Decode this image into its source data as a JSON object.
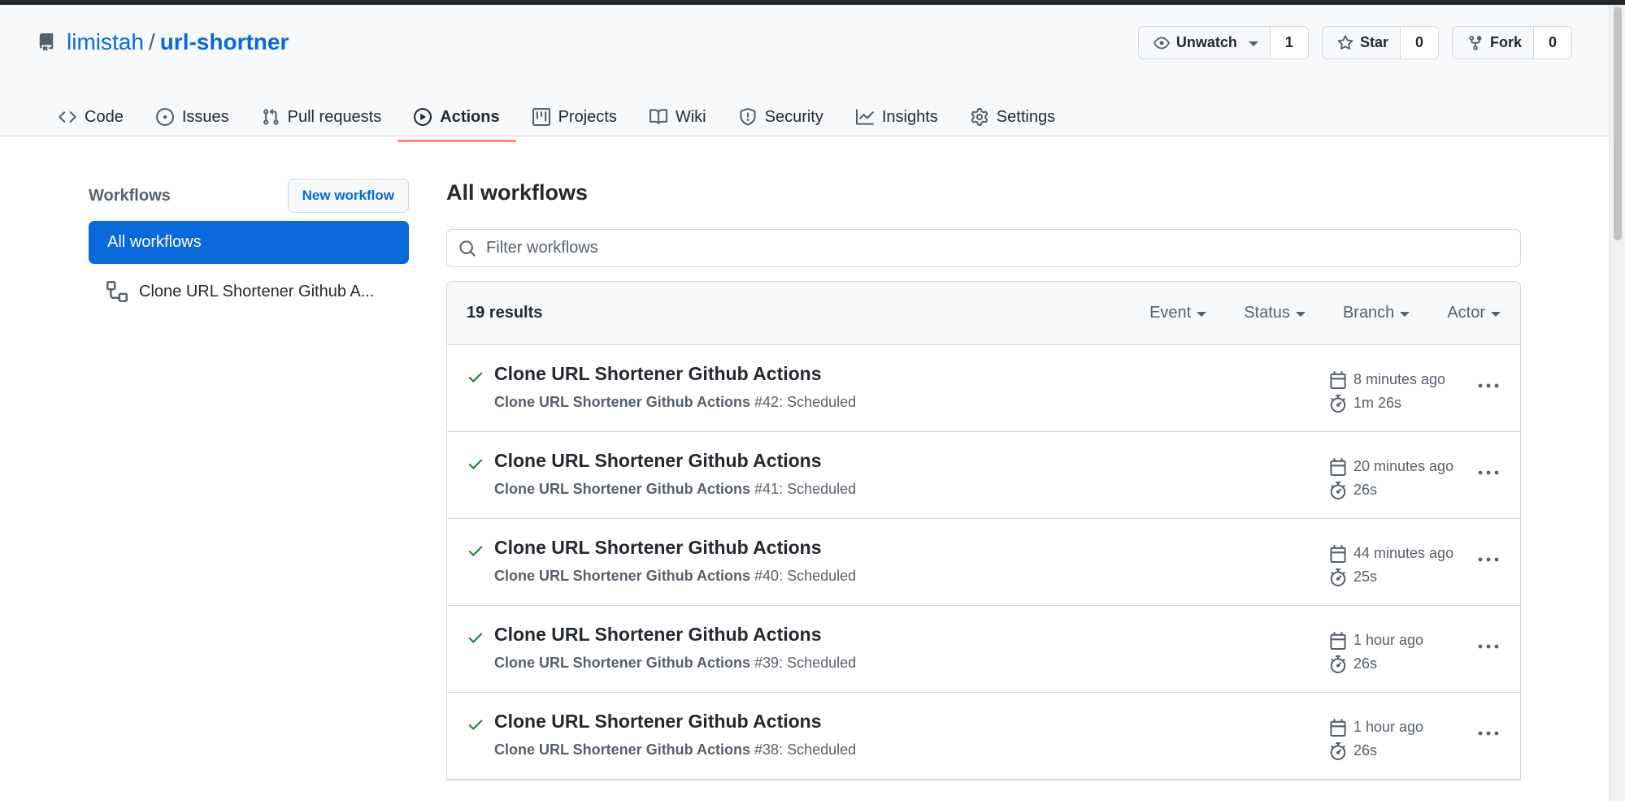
{
  "repo": {
    "owner": "limistah",
    "separator": "/",
    "name": "url-shortner",
    "icon": "repo-icon"
  },
  "actions": {
    "watch": {
      "label": "Unwatch",
      "count": "1",
      "icon": "eye-icon"
    },
    "star": {
      "label": "Star",
      "count": "0",
      "icon": "star-icon"
    },
    "fork": {
      "label": "Fork",
      "count": "0",
      "icon": "fork-icon"
    }
  },
  "tabs": [
    {
      "label": "Code",
      "icon": "code-icon"
    },
    {
      "label": "Issues",
      "icon": "issue-icon"
    },
    {
      "label": "Pull requests",
      "icon": "pull-request-icon"
    },
    {
      "label": "Actions",
      "icon": "play-icon",
      "active": true
    },
    {
      "label": "Projects",
      "icon": "project-icon"
    },
    {
      "label": "Wiki",
      "icon": "book-icon"
    },
    {
      "label": "Security",
      "icon": "shield-icon"
    },
    {
      "label": "Insights",
      "icon": "graph-icon"
    },
    {
      "label": "Settings",
      "icon": "gear-icon"
    }
  ],
  "sidebar": {
    "title": "Workflows",
    "new_workflow": "New workflow",
    "active_item": "All workflows",
    "items": [
      {
        "label": "Clone URL Shortener Github A...",
        "icon": "workflow-icon"
      }
    ]
  },
  "main": {
    "title": "All workflows",
    "filter_placeholder": "Filter workflows",
    "results_count": "19 results",
    "filters": [
      "Event",
      "Status",
      "Branch",
      "Actor"
    ],
    "runs": [
      {
        "title": "Clone URL Shortener Github Actions",
        "workflow": "Clone URL Shortener Github Actions",
        "detail": "#42: Scheduled",
        "time": "8 minutes ago",
        "duration": "1m 26s"
      },
      {
        "title": "Clone URL Shortener Github Actions",
        "workflow": "Clone URL Shortener Github Actions",
        "detail": "#41: Scheduled",
        "time": "20 minutes ago",
        "duration": "26s"
      },
      {
        "title": "Clone URL Shortener Github Actions",
        "workflow": "Clone URL Shortener Github Actions",
        "detail": "#40: Scheduled",
        "time": "44 minutes ago",
        "duration": "25s"
      },
      {
        "title": "Clone URL Shortener Github Actions",
        "workflow": "Clone URL Shortener Github Actions",
        "detail": "#39: Scheduled",
        "time": "1 hour ago",
        "duration": "26s"
      },
      {
        "title": "Clone URL Shortener Github Actions",
        "workflow": "Clone URL Shortener Github Actions",
        "detail": "#38: Scheduled",
        "time": "1 hour ago",
        "duration": "26s"
      }
    ]
  },
  "colors": {
    "accent": "#0969da",
    "success": "#1a7f37",
    "tab_underline": "#fd8c73"
  }
}
